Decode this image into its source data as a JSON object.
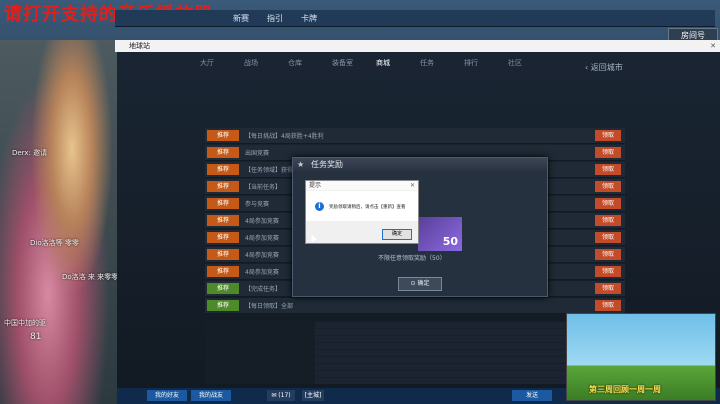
{
  "overlay": {
    "banner": "请打开支持的音乐播放器",
    "chat": [
      {
        "text": "Derx:  邀请"
      },
      {
        "text": "Dio洛洛等 零零"
      },
      {
        "text": "Do洛洛 来 来零零的开"
      },
      {
        "text": "中国中加的驱 "
      },
      {
        "text": "81"
      }
    ]
  },
  "client": {
    "tabs": [
      "新赛",
      "指引",
      "卡牌"
    ],
    "room_badge": "房间号",
    "window_title": "地球站"
  },
  "game": {
    "nav": [
      "大厅",
      "战场",
      "仓库",
      "装备室",
      "商城",
      "任务",
      "排行",
      "社区"
    ],
    "back": "返回城市",
    "rows": [
      {
        "tag": "推荐",
        "text": "【每日挑战】4局获胜+4胜利",
        "button": "领取",
        "green": false
      },
      {
        "tag": "推荐",
        "text": "出国竞赛",
        "button": "领取",
        "green": false
      },
      {
        "tag": "推荐",
        "text": "【任务领域】获得",
        "button": "领取",
        "green": false
      },
      {
        "tag": "推荐",
        "text": "【当前任务】",
        "button": "领取",
        "green": false
      },
      {
        "tag": "推荐",
        "text": "参与竞赛",
        "button": "领取",
        "green": false
      },
      {
        "tag": "推荐",
        "text": "4局参加竞赛",
        "button": "领取",
        "green": false
      },
      {
        "tag": "推荐",
        "text": "4局参加竞赛",
        "button": "领取",
        "green": false
      },
      {
        "tag": "推荐",
        "text": "4局参加竞赛",
        "button": "领取",
        "green": false
      },
      {
        "tag": "推荐",
        "text": "4局参加竞赛",
        "button": "领取",
        "green": false
      },
      {
        "tag": "推荐",
        "text": "【完成任务】",
        "button": "领取",
        "green": true
      },
      {
        "tag": "推荐",
        "text": "【每日领取】全部",
        "button": "领取",
        "green": true
      }
    ],
    "reward_dialog": {
      "title": "任务奖励",
      "reward_value": "50",
      "reward_caption": "不限任意领取奖励（50）",
      "confirm": "确定"
    },
    "msgbox": {
      "title": "提示",
      "message": "奖励领取请稍后，请点击【重新】查看",
      "ok": "确定"
    },
    "taskbar": [
      "我的好友",
      "我的战友",
      "(17)",
      "[主城]",
      "发送"
    ]
  },
  "thumbnail": {
    "caption": "第三周回顾一周一周"
  }
}
